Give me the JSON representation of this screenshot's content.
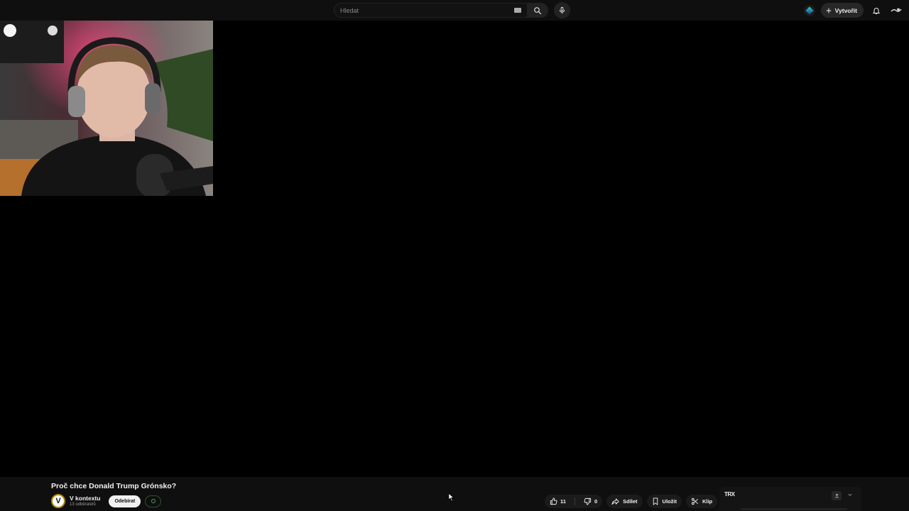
{
  "search": {
    "placeholder": "Hledat"
  },
  "header": {
    "create_label": "Vytvořit"
  },
  "video": {
    "title": "Proč chce Donald Trump Grónsko?",
    "channel_initial": "V",
    "channel_name": "V kontextu",
    "subscribers": "13 odběratelů",
    "subscribe_label": "Odebírat"
  },
  "actions": {
    "likes": "11",
    "dislikes": "0",
    "share_label": "Sdílet",
    "save_label": "Uložit",
    "clip_label": "Klip"
  },
  "side_panel": {
    "logo_text": "TRX"
  },
  "colors": {
    "background": "#0f0f0f",
    "player": "#000000",
    "accent": "#3ea66a"
  }
}
